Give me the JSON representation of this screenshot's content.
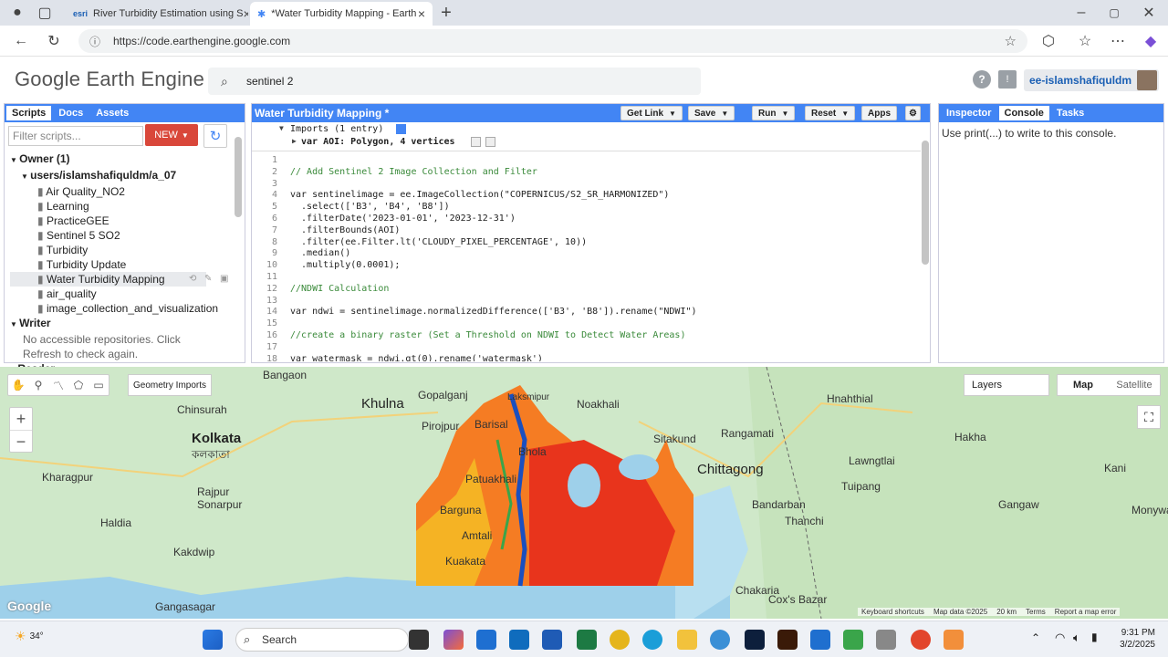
{
  "browser": {
    "tabs": [
      {
        "label": "River Turbidity Estimation using S",
        "favicon": "esri"
      },
      {
        "label": "*Water Turbidity Mapping - Earth",
        "favicon": "earth-engine"
      }
    ],
    "url": "https://code.earthengine.google.com"
  },
  "header": {
    "logo": "Google Earth Engine",
    "search_value": "sentinel 2",
    "user": "ee-islamshafiquldm"
  },
  "left_panel": {
    "tabs": [
      "Scripts",
      "Docs",
      "Assets"
    ],
    "filter_placeholder": "Filter scripts...",
    "new_label": "NEW",
    "owner": "Owner (1)",
    "repo": "users/islamshafiquldm/a_07",
    "files": [
      "Air Quality_NO2",
      "Learning",
      "PracticeGEE",
      "Sentinel 5 SO2",
      "Turbidity",
      "Turbidity Update",
      "Water Turbidity Mapping",
      "air_quality",
      "image_collection_and_visualization"
    ],
    "writer": "Writer",
    "writer_msg": "No accessible repositories. Click Refresh to check again.",
    "reader": "Reader"
  },
  "editor": {
    "title": "Water Turbidity Mapping *",
    "buttons": [
      "Get Link",
      "Save",
      "Run",
      "Reset",
      "Apps"
    ],
    "imports_line": "Imports (1 entry)",
    "imports_var": "var AOI: Polygon, 4 vertices",
    "lines": [
      "",
      "// Add Sentinel 2 Image Collection and Filter",
      "",
      "var sentinelimage = ee.ImageCollection(\"COPERNICUS/S2_SR_HARMONIZED\")",
      "  .select(['B3', 'B4', 'B8'])",
      "  .filterDate('2023-01-01', '2023-12-31')",
      "  .filterBounds(AOI)",
      "  .filter(ee.Filter.lt('CLOUDY_PIXEL_PERCENTAGE', 10))",
      "  .median()",
      "  .multiply(0.0001);",
      "",
      "//NDWI Calculation",
      "",
      "var ndwi = sentinelimage.normalizedDifference(['B3', 'B8']).rename(\"NDWI\")",
      "",
      "//create a binary raster (Set a Threshold on NDWI to Detect Water Areas)",
      "",
      "var watermask = ndwi.gt(0).rename('watermask')"
    ]
  },
  "right_panel": {
    "tabs": [
      "Inspector",
      "Console",
      "Tasks"
    ],
    "console_msg": "Use print(...) to write to this console."
  },
  "map": {
    "geometry_imports": "Geometry Imports",
    "layers": "Layers",
    "map_type": [
      "Map",
      "Satellite"
    ],
    "labels": [
      "Bangaon",
      "Khulna",
      "Kolkata",
      "কলকাতা",
      "Kharagpur",
      "Rajpur Sonarpur",
      "Haldia",
      "Kakdwip",
      "Gangasagar",
      "Chinsurah",
      "Gopalganj",
      "Barisal",
      "Bhola",
      "Patuakhali",
      "Barguna",
      "Amtali",
      "Kuakata",
      "Pirojpur",
      "Noakhali",
      "Laksmipur",
      "Sitakund",
      "Rangamati",
      "Chittagong",
      "Bandarban",
      "Thanchi",
      "Lawngtlai",
      "Hnahthial",
      "Hakha",
      "Tuipang",
      "Gangaw",
      "Kani",
      "Monywa",
      "Chakaria",
      "Cox's Bazar"
    ],
    "attribution": [
      "Keyboard shortcuts",
      "Map data ©2025",
      "20 km",
      "Terms",
      "Report a map error"
    ]
  },
  "taskbar": {
    "weather": "34°",
    "search_placeholder": "Search",
    "time": "9:31 PM",
    "date": "3/2/2025"
  }
}
